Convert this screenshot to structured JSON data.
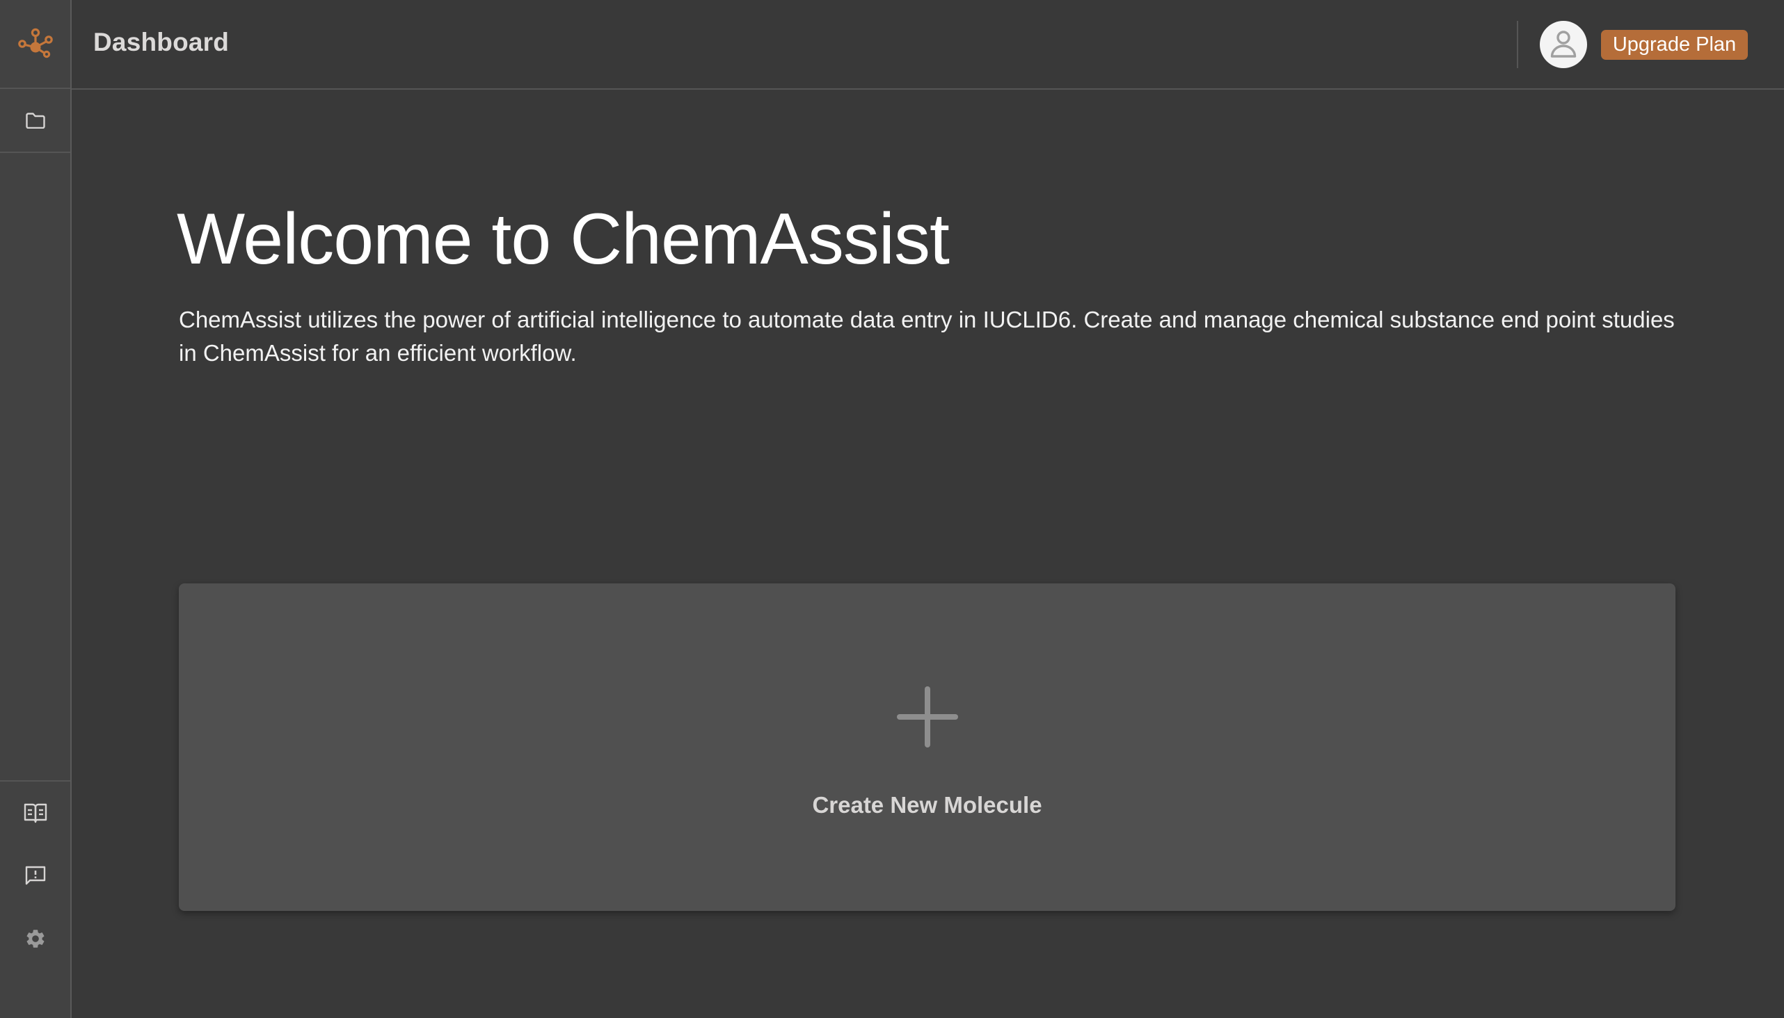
{
  "app": {
    "name": "ChemAssist",
    "accent_color": "#b56d39"
  },
  "sidebar": {
    "logo_icon": "molecule-icon",
    "top_items": [
      {
        "icon": "folder-icon",
        "label": "Projects"
      }
    ],
    "bottom_items": [
      {
        "icon": "book-icon",
        "label": "Documentation"
      },
      {
        "icon": "feedback-icon",
        "label": "Feedback"
      },
      {
        "icon": "gear-icon",
        "label": "Settings"
      }
    ]
  },
  "header": {
    "title": "Dashboard",
    "avatar_icon": "user-icon",
    "upgrade_label": "Upgrade Plan"
  },
  "main": {
    "welcome_title": "Welcome to ChemAssist",
    "welcome_description": "ChemAssist utilizes the power of artificial intelligence to automate data entry in IUCLID6. Create and manage chemical substance end point studies in ChemAssist for an efficient workflow.",
    "create_card": {
      "icon": "plus-icon",
      "label": "Create New Molecule"
    }
  }
}
